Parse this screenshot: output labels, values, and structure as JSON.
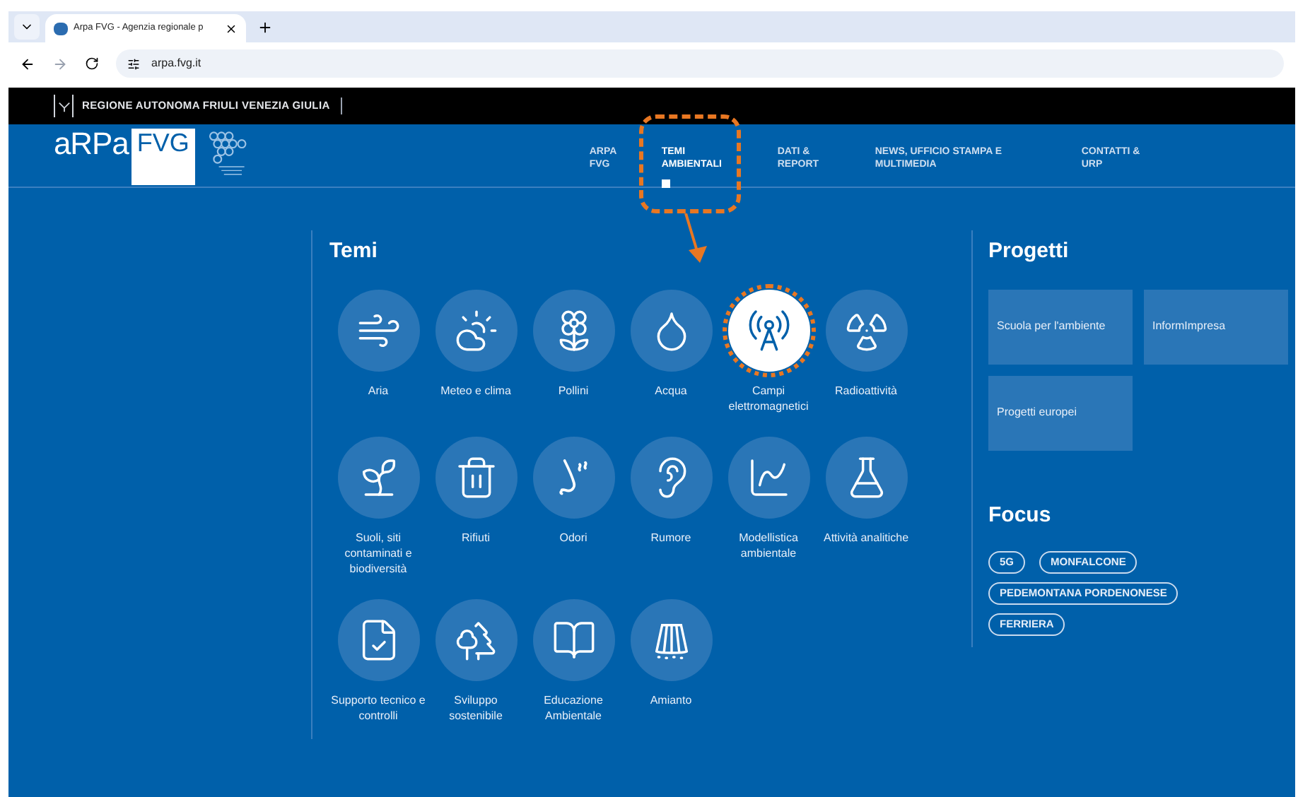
{
  "browser": {
    "tab_title": "Arpa FVG - Agenzia regionale p",
    "url": "arpa.fvg.it"
  },
  "region_bar": {
    "title": "REGIONE AUTONOMA FRIULI VENEZIA GIULIA"
  },
  "logo": {
    "text": "aRPa",
    "badge": "FVG"
  },
  "nav": [
    {
      "label": "ARPA FVG",
      "selected": false
    },
    {
      "label": "TEMI AMBIENTALI",
      "selected": true
    },
    {
      "label": "DATI & REPORT",
      "selected": false
    },
    {
      "label": "NEWS, UFFICIO STAMPA E MULTIMEDIA",
      "selected": false
    },
    {
      "label": "CONTATTI & URP",
      "selected": false
    }
  ],
  "themes": {
    "title": "Temi",
    "items": [
      {
        "label": "Aria",
        "highlighted": false
      },
      {
        "label": "Meteo e clima",
        "highlighted": false
      },
      {
        "label": "Pollini",
        "highlighted": false
      },
      {
        "label": "Acqua",
        "highlighted": false
      },
      {
        "label": "Campi elettromagnetici",
        "highlighted": true
      },
      {
        "label": "Radioattività",
        "highlighted": false
      },
      {
        "label": "Suoli, siti contaminati e biodiversità",
        "highlighted": false
      },
      {
        "label": "Rifiuti",
        "highlighted": false
      },
      {
        "label": "Odori",
        "highlighted": false
      },
      {
        "label": "Rumore",
        "highlighted": false
      },
      {
        "label": "Modellistica ambientale",
        "highlighted": false
      },
      {
        "label": "Attività analitiche",
        "highlighted": false
      },
      {
        "label": "Supporto tecnico e controlli",
        "highlighted": false
      },
      {
        "label": "Sviluppo sostenibile",
        "highlighted": false
      },
      {
        "label": "Educazione Ambientale",
        "highlighted": false
      },
      {
        "label": "Amianto",
        "highlighted": false
      }
    ]
  },
  "projects": {
    "title": "Progetti",
    "items": [
      "Scuola per l'ambiente",
      "InformImpresa",
      "Progetti europei"
    ]
  },
  "focus": {
    "title": "Focus",
    "tags": [
      "5G",
      "MONFALCONE",
      "PEDEMONTANA PORDENONESE",
      "FERRIERA"
    ]
  }
}
